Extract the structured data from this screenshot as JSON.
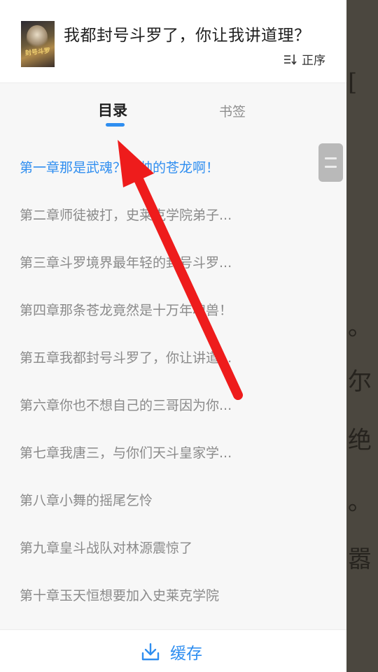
{
  "book": {
    "title": "我都封号斗罗了，你让我讲道理？",
    "cover_text": "封号斗罗"
  },
  "sort": {
    "label": "正序",
    "icon": "sort-order-icon"
  },
  "tabs": [
    {
      "label": "目录",
      "active": true
    },
    {
      "label": "书签",
      "active": false
    }
  ],
  "chapters": [
    {
      "label": "第一章那是武魂？好帅的苍龙啊！",
      "active": true
    },
    {
      "label": "第二章师徒被打，史莱克学院弟子...",
      "active": false
    },
    {
      "label": "第三章斗罗境界最年轻的封号斗罗...",
      "active": false
    },
    {
      "label": "第四章那条苍龙竟然是十万年魂兽！",
      "active": false
    },
    {
      "label": "第五章我都封号斗罗了，你让讲道...",
      "active": false
    },
    {
      "label": "第六章你也不想自己的三哥因为你...",
      "active": false
    },
    {
      "label": "第七章我唐三，与你们天斗皇家学...",
      "active": false
    },
    {
      "label": "第八章小舞的摇尾乞怜",
      "active": false
    },
    {
      "label": "第九章皇斗战队对林源震惊了",
      "active": false
    },
    {
      "label": "第十章玉天恒想要加入史莱克学院",
      "active": false
    }
  ],
  "footer": {
    "cache_label": "缓存",
    "icon": "download-icon"
  },
  "reader_glyphs": [
    "[",
    "。",
    "尔",
    "绝",
    "。",
    "嚣"
  ],
  "colors": {
    "accent": "#2f8ef0",
    "annotation_arrow": "#ee1c1c"
  }
}
